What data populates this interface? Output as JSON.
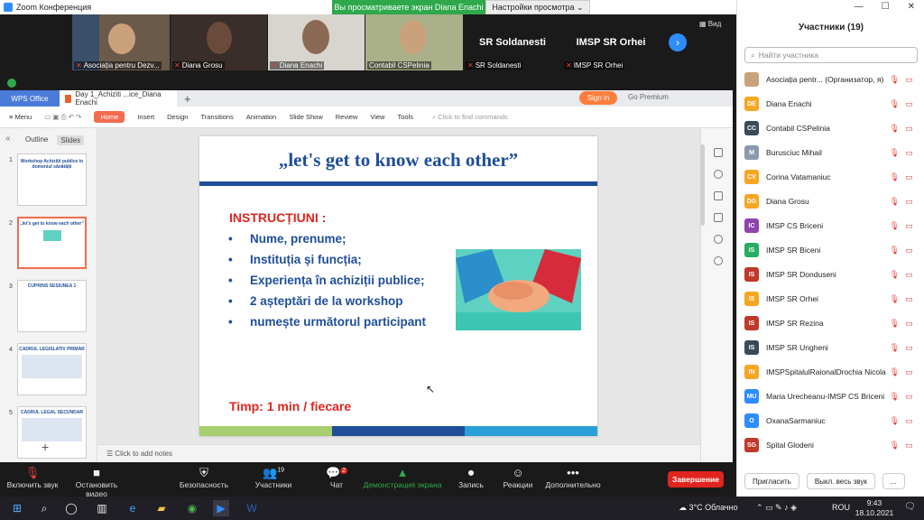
{
  "window": {
    "title": "Zoom Конференция"
  },
  "share_banner": "Вы просматриваете экран Diana Enachi",
  "view_options": "Настройки просмотра ⌄",
  "video_tiles": [
    {
      "name": "Asociația pentru Dezv..."
    },
    {
      "name": "Diana Grosu"
    },
    {
      "name": "Diana Enachi"
    },
    {
      "name": "Contabil CSPelinia"
    },
    {
      "name": "SR Soldanesti",
      "label": "SR Soldanesti"
    },
    {
      "name": "IMSP SR Orhei",
      "label": "IMSP SR Orhei"
    }
  ],
  "view_button": "Вид",
  "wps": {
    "app_tab": "WPS Office",
    "doc_tab": "Day 1_Achiziti ...ice_Diana Enachi",
    "sign_in": "Sign in",
    "go_premium": "Go Premium",
    "menu": "≡ Menu",
    "ribbon": [
      "Home",
      "Insert",
      "Design",
      "Transitions",
      "Animation",
      "Slide Show",
      "Review",
      "View",
      "Tools"
    ],
    "search_placeholder": "Click to find commands",
    "panel_tabs": [
      "Outline",
      "Slides"
    ],
    "notes_placeholder": "Click to add notes"
  },
  "thumbnails": [
    {
      "num": "1",
      "text": "Workshop Achiziții publice în domeniul sănătății"
    },
    {
      "num": "2",
      "text": "„let's get to know each other”"
    },
    {
      "num": "3",
      "text": "CUPRINS SESIUNEA 1"
    },
    {
      "num": "4",
      "text": "CADRUL LEGISLATIV PRIMAR"
    },
    {
      "num": "5",
      "text": "CADRUL LEGAL SECUNDAR"
    }
  ],
  "slide": {
    "title": "„let's get to know each other”",
    "instructions_heading": "INSTRUCȚIUNI :",
    "bullets": [
      "Nume, prenume;",
      "Instituția și funcția;",
      "Experiența în achiziții publice;",
      "2 așteptări de la workshop",
      "numește următorul participant"
    ],
    "timing": "Timp: 1 min / fiecare"
  },
  "participants": {
    "title": "Участники (19)",
    "search_placeholder": "Найти участника",
    "list": [
      {
        "initials": "",
        "name": "Asociația pentr... (Организатор, я)",
        "color": "#c9a27c"
      },
      {
        "initials": "DE",
        "name": "Diana Enachi",
        "color": "#f5a623"
      },
      {
        "initials": "CC",
        "name": "Contabil CSPelinia",
        "color": "#3b4a5a"
      },
      {
        "initials": "M",
        "name": "Burusciuc Mihail",
        "color": "#8a9bb0"
      },
      {
        "initials": "CV",
        "name": "Corina Vatamaniuc",
        "color": "#f5a623"
      },
      {
        "initials": "DG",
        "name": "Diana Grosu",
        "color": "#f5a623"
      },
      {
        "initials": "IC",
        "name": "IMSP CS Briceni",
        "color": "#8e44ad"
      },
      {
        "initials": "IS",
        "name": "IMSP SR Biceni",
        "color": "#27ae60"
      },
      {
        "initials": "IS",
        "name": "IMSP SR Donduseni",
        "color": "#c0392b"
      },
      {
        "initials": "IS",
        "name": "IMSP SR Orhei",
        "color": "#f5a623"
      },
      {
        "initials": "IS",
        "name": "IMSP SR Rezina",
        "color": "#c0392b"
      },
      {
        "initials": "IS",
        "name": "IMSP SR Ungheni",
        "color": "#3b4a5a"
      },
      {
        "initials": "IN",
        "name": "IMSPSpitalulRaionalDrochia NicolaeT...",
        "color": "#f5a623"
      },
      {
        "initials": "MU",
        "name": "Maria Urecheanu-IMSP CS Briceni",
        "color": "#2d8cff"
      },
      {
        "initials": "O",
        "name": "OxanaSarmaniuc",
        "color": "#2d8cff"
      },
      {
        "initials": "SG",
        "name": "Spital Glodeni",
        "color": "#c0392b"
      }
    ],
    "invite": "Пригласить",
    "mute_all": "Выкл. весь звук",
    "more": "..."
  },
  "toolbar": {
    "unmute": "Включить звук",
    "start_video": "Остановить видео",
    "security": "Безопасность",
    "participants": "Участники",
    "participants_count": "19",
    "chat": "Чат",
    "chat_badge": "2",
    "share": "Демонстрация экрана",
    "record": "Запись",
    "reactions": "Реакции",
    "more": "Дополнительно",
    "end": "Завершение"
  },
  "taskbar": {
    "weather": "3°C Облачно",
    "lang": "ROU",
    "time": "9:43",
    "date": "18.10.2021"
  },
  "colors": {
    "zoom_blue": "#2d8cff",
    "share_green": "#2ea84b",
    "slide_blue": "#1f4e9a",
    "slide_red": "#e0241f",
    "wps_accent": "#f36c4f"
  }
}
